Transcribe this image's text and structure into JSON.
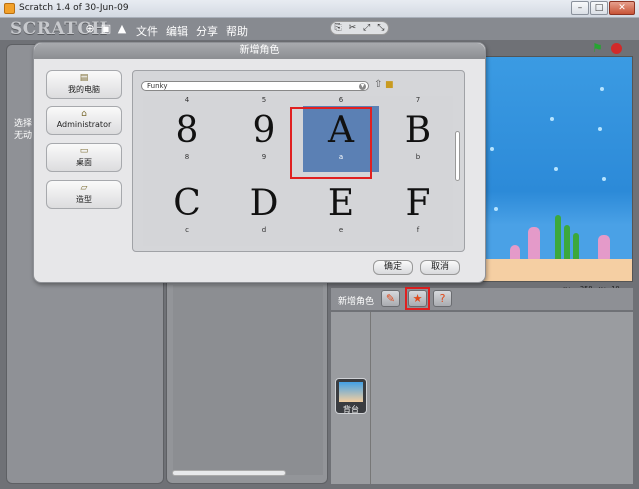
{
  "window": {
    "title": "Scratch 1.4 of 30-Jun-09",
    "buttons": [
      "–",
      "□",
      "✕"
    ]
  },
  "menubar": {
    "logo": "SCRATCH",
    "menus": [
      "文件",
      "编辑",
      "分享",
      "帮助"
    ]
  },
  "left_pane_note": [
    "选择",
    "无动"
  ],
  "stage_coords": {
    "x_label": "x: -258",
    "y_label": "y: 10"
  },
  "sprite_bar": {
    "label": "新增角色"
  },
  "stage_thumb": {
    "label": "背台"
  },
  "dialog": {
    "title": "新增角色",
    "locations": [
      {
        "label": "我的电脑",
        "icon": "computer-icon"
      },
      {
        "label": "Administrator",
        "icon": "home-icon"
      },
      {
        "label": "桌面",
        "icon": "folder-icon"
      },
      {
        "label": "造型",
        "icon": "costume-folder-icon"
      }
    ],
    "path": "Funky",
    "top_row_labels": [
      "4",
      "5",
      "6",
      "7"
    ],
    "items": [
      {
        "glyph": "8",
        "caption": "8"
      },
      {
        "glyph": "9",
        "caption": "9"
      },
      {
        "glyph": "A",
        "caption": "a",
        "selected": true
      },
      {
        "glyph": "B",
        "caption": "b"
      },
      {
        "glyph": "C",
        "caption": "c"
      },
      {
        "glyph": "D",
        "caption": "d"
      },
      {
        "glyph": "E",
        "caption": "e"
      },
      {
        "glyph": "F",
        "caption": "f"
      }
    ],
    "ok_label": "确定",
    "cancel_label": "取消"
  },
  "colors": {
    "selection": "#5b80b4",
    "highlight": "#e02020",
    "stage_water": "#2c8ad8"
  }
}
